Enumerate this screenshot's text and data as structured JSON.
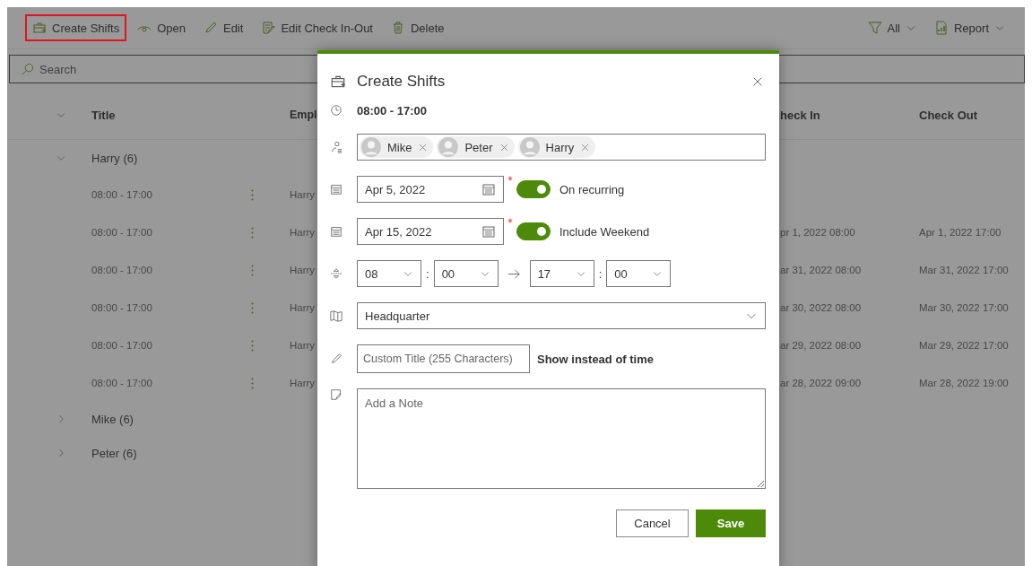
{
  "toolbar": {
    "left": [
      {
        "kind": "briefcase",
        "label": "Create Shifts",
        "highlighted": true
      },
      {
        "kind": "eye",
        "label": "Open",
        "highlighted": false
      },
      {
        "kind": "pencil",
        "label": "Edit",
        "highlighted": false
      },
      {
        "kind": "doc-edit",
        "label": "Edit Check In-Out",
        "highlighted": false
      },
      {
        "kind": "trash",
        "label": "Delete",
        "highlighted": false
      }
    ],
    "right": [
      {
        "kind": "filter",
        "label": "All"
      },
      {
        "kind": "report",
        "label": "Report"
      }
    ]
  },
  "search": {
    "placeholder": "Search"
  },
  "table": {
    "columns": [
      "Title",
      "Empl",
      "heck In",
      "Check Out"
    ],
    "groups": [
      {
        "label": "Harry (6)",
        "expanded": true,
        "rows": [
          {
            "title": "08:00 - 17:00",
            "employee": "Harry"
          },
          {
            "title": "08:00 - 17:00",
            "employee": "Harry",
            "check_in": "pr 1, 2022 08:00",
            "check_out": "Apr 1, 2022 17:00"
          },
          {
            "title": "08:00 - 17:00",
            "employee": "Harry",
            "check_in": "ar 31, 2022 08:00",
            "check_out": "Mar 31, 2022 17:00"
          },
          {
            "title": "08:00 - 17:00",
            "employee": "Harry",
            "check_in": "ar 30, 2022 08:00",
            "check_out": "Mar 30, 2022 17:00"
          },
          {
            "title": "08:00 - 17:00",
            "employee": "Harry",
            "check_in": "ar 29, 2022 08:00",
            "check_out": "Mar 29, 2022 17:00"
          },
          {
            "title": "08:00 - 17:00",
            "employee": "Harry",
            "check_in": "ar 28, 2022 09:00",
            "check_out": "Mar 28, 2022 19:00"
          }
        ]
      },
      {
        "label": "Mike (6)",
        "expanded": false
      },
      {
        "label": "Peter (6)",
        "expanded": false
      }
    ]
  },
  "dialog": {
    "title": "Create Shifts",
    "time_summary": "08:00 - 17:00",
    "people": [
      "Mike",
      "Peter",
      "Harry"
    ],
    "start_date": {
      "value": "Apr 5, 2022",
      "required": true,
      "toggle_label": "On recurring",
      "toggle_on": true
    },
    "end_date": {
      "value": "Apr 15, 2022",
      "required": true,
      "toggle_label": "Include Weekend",
      "toggle_on": true
    },
    "time": {
      "start_hour": "08",
      "start_minute": "00",
      "end_hour": "17",
      "end_minute": "00",
      "separator": ":"
    },
    "location": "Headquarter",
    "custom_title": {
      "placeholder": "Custom Title (255 Characters)",
      "hint": "Show instead of time"
    },
    "note": {
      "placeholder": "Add a Note"
    },
    "buttons": [
      {
        "kind": "secondary",
        "label": "Cancel"
      },
      {
        "kind": "primary",
        "label": "Save"
      }
    ]
  }
}
